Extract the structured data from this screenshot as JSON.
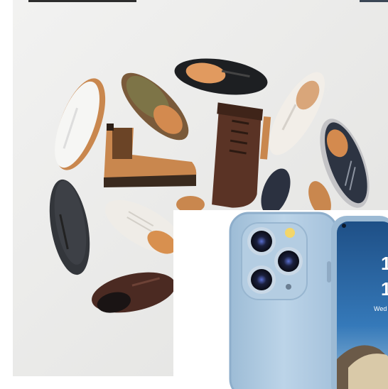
{
  "collage": {
    "shoes_image": {
      "label": "",
      "items": [
        "white-sneaker",
        "suede-loafer",
        "black-loafer",
        "white-sneaker",
        "tan-chelsea-boot",
        "brown-lace-up-boot",
        "navy-sneaker",
        "charcoal-sneaker",
        "white-low-top",
        "brown-derby-shoe"
      ]
    },
    "phone_image": {
      "label": "",
      "color": "#a9c7df",
      "screen_time_hour": "1",
      "screen_time_minute": "1",
      "screen_date": "Wed"
    }
  },
  "colors": {
    "background": "#ebebea",
    "tan": "#c9874e",
    "brown": "#5a3325",
    "navy": "#2d3442",
    "phone_blue": "#a9c7df",
    "screen_blue": "#2a5f96"
  }
}
